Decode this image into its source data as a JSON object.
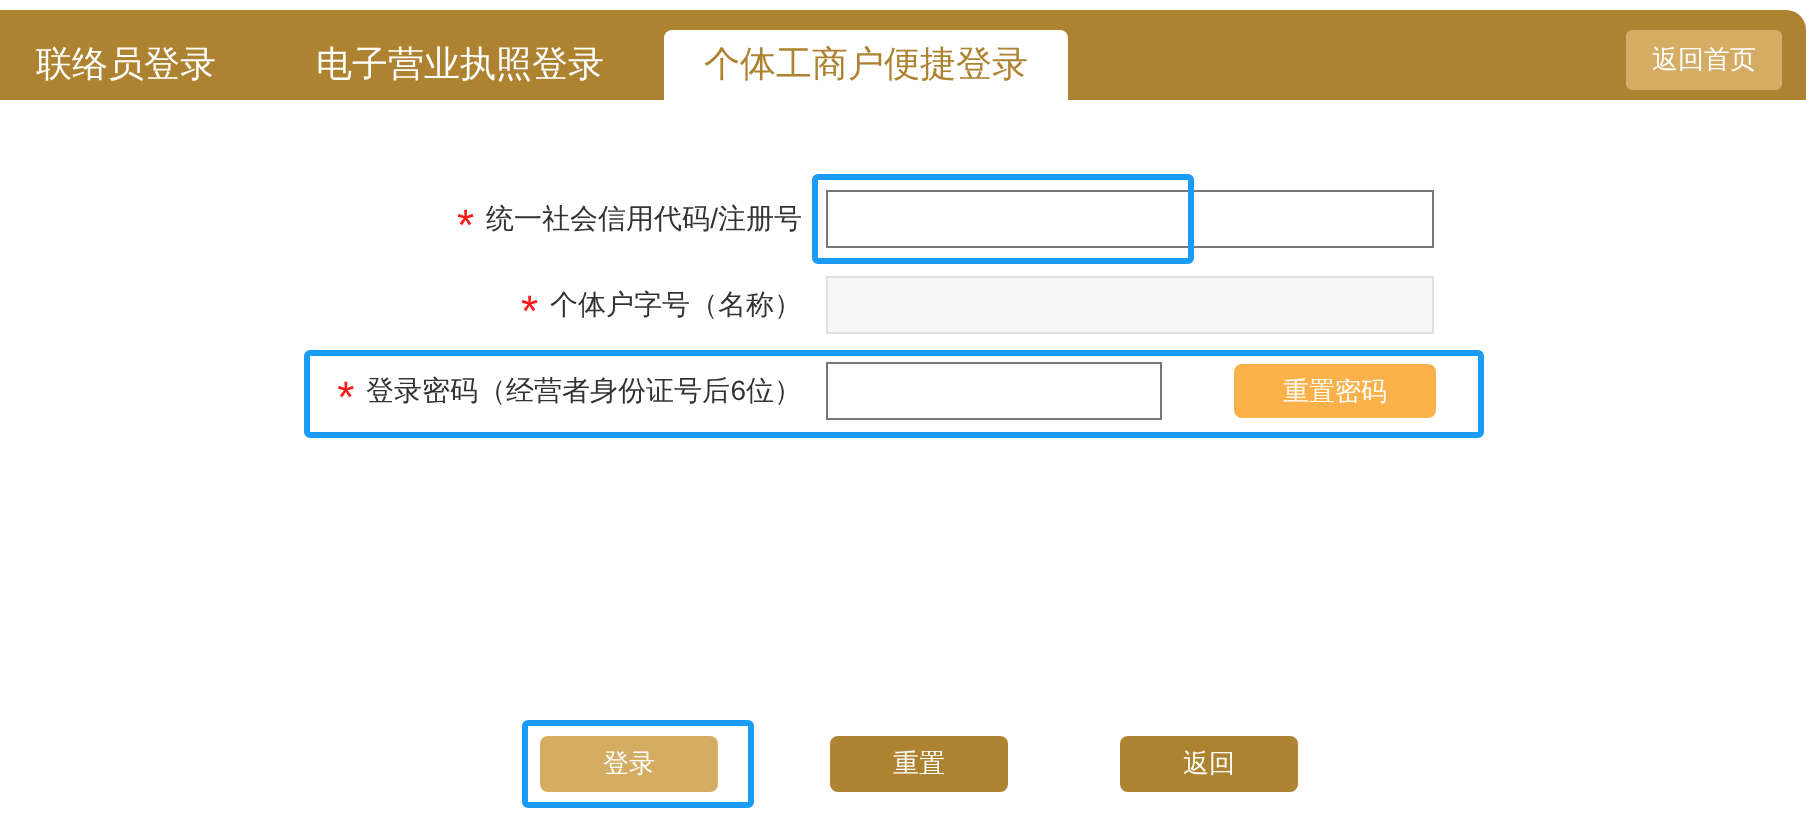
{
  "tabs": [
    {
      "label": "联络员登录",
      "selected": false
    },
    {
      "label": "电子营业执照登录",
      "selected": false
    },
    {
      "label": "个体工商户便捷登录",
      "selected": true
    }
  ],
  "home_button": "返回首页",
  "fields": [
    {
      "required_mark": "*",
      "label": "统一社会信用代码/注册号",
      "disabled": false,
      "highlighted": true
    },
    {
      "required_mark": "*",
      "label": "个体户字号（名称）",
      "disabled": true,
      "highlighted": false
    },
    {
      "required_mark": "*",
      "label": "登录密码（经营者身份证号后6位）",
      "disabled": false,
      "highlighted": true,
      "action": "重置密码"
    }
  ],
  "buttons": [
    {
      "label": "登录",
      "kind": "primary",
      "highlighted": true
    },
    {
      "label": "重置",
      "kind": "secondary",
      "highlighted": false
    },
    {
      "label": "返回",
      "kind": "secondary",
      "highlighted": false
    }
  ]
}
